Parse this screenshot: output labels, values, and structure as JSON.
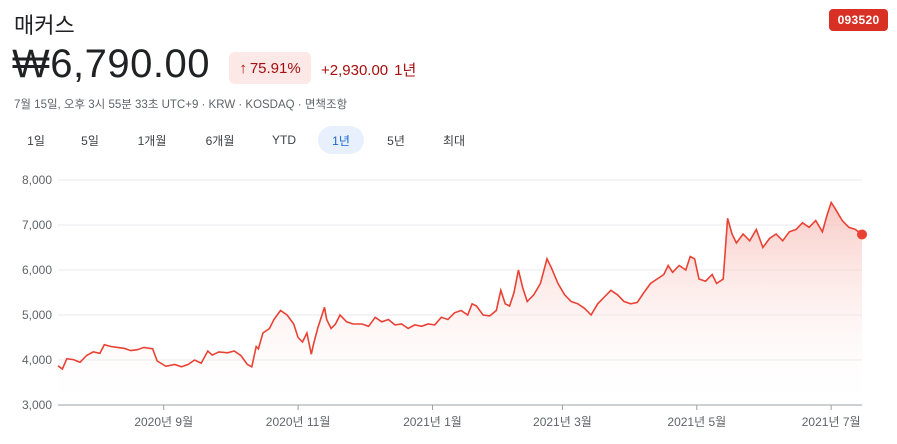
{
  "header": {
    "name": "매커스",
    "ticker": "093520",
    "price": "₩6,790.00",
    "pct_arrow": "↑",
    "pct_change": "75.91%",
    "abs_change": "+2,930.00",
    "period": "1년",
    "meta": "7월 15일, 오후 3시 55분 33초 UTC+9 · KRW · KOSDAQ · 면책조항"
  },
  "tabs": [
    {
      "label": "1일",
      "active": false
    },
    {
      "label": "5일",
      "active": false
    },
    {
      "label": "1개월",
      "active": false
    },
    {
      "label": "6개월",
      "active": false
    },
    {
      "label": "YTD",
      "active": false
    },
    {
      "label": "1년",
      "active": true
    },
    {
      "label": "5년",
      "active": false
    },
    {
      "label": "최대",
      "active": false
    }
  ],
  "colors": {
    "line": "#e94235",
    "fill_top": "#f6b8b2",
    "badge": "#d93025",
    "negative_text": "#a50e0e",
    "active_tab_bg": "#e8f0fe"
  },
  "chart_data": {
    "type": "area",
    "ylim": [
      3000,
      8000
    ],
    "yticks": [
      3000,
      4000,
      5000,
      6000,
      7000,
      8000
    ],
    "ytick_labels": [
      "3,000",
      "4,000",
      "5,000",
      "6,000",
      "7,000",
      "8,000"
    ],
    "xlim": [
      "2020-07-15",
      "2021-07-15"
    ],
    "xticks": [
      {
        "date": "2020-09-01",
        "label": "2020년 9월"
      },
      {
        "date": "2020-11-01",
        "label": "2020년 11월"
      },
      {
        "date": "2021-01-01",
        "label": "2021년 1월"
      },
      {
        "date": "2021-03-01",
        "label": "2021년 3월"
      },
      {
        "date": "2021-05-01",
        "label": "2021년 5월"
      },
      {
        "date": "2021-07-01",
        "label": "2021년 7월"
      }
    ],
    "grid": true,
    "series": [
      {
        "points": [
          [
            "2020-07-15",
            3870
          ],
          [
            "2020-07-17",
            3800
          ],
          [
            "2020-07-19",
            4030
          ],
          [
            "2020-07-22",
            4010
          ],
          [
            "2020-07-25",
            3950
          ],
          [
            "2020-07-28",
            4100
          ],
          [
            "2020-07-31",
            4180
          ],
          [
            "2020-08-03",
            4150
          ],
          [
            "2020-08-05",
            4340
          ],
          [
            "2020-08-08",
            4300
          ],
          [
            "2020-08-11",
            4280
          ],
          [
            "2020-08-14",
            4260
          ],
          [
            "2020-08-17",
            4210
          ],
          [
            "2020-08-20",
            4230
          ],
          [
            "2020-08-23",
            4280
          ],
          [
            "2020-08-27",
            4250
          ],
          [
            "2020-08-29",
            3980
          ],
          [
            "2020-09-02",
            3860
          ],
          [
            "2020-09-06",
            3900
          ],
          [
            "2020-09-09",
            3850
          ],
          [
            "2020-09-12",
            3900
          ],
          [
            "2020-09-15",
            4000
          ],
          [
            "2020-09-18",
            3930
          ],
          [
            "2020-09-21",
            4200
          ],
          [
            "2020-09-23",
            4110
          ],
          [
            "2020-09-26",
            4180
          ],
          [
            "2020-09-30",
            4160
          ],
          [
            "2020-10-03",
            4200
          ],
          [
            "2020-10-06",
            4100
          ],
          [
            "2020-10-09",
            3900
          ],
          [
            "2020-10-11",
            3850
          ],
          [
            "2020-10-13",
            4300
          ],
          [
            "2020-10-14",
            4250
          ],
          [
            "2020-10-16",
            4600
          ],
          [
            "2020-10-19",
            4700
          ],
          [
            "2020-10-21",
            4900
          ],
          [
            "2020-10-24",
            5100
          ],
          [
            "2020-10-27",
            5000
          ],
          [
            "2020-10-30",
            4800
          ],
          [
            "2020-11-01",
            4500
          ],
          [
            "2020-11-03",
            4400
          ],
          [
            "2020-11-05",
            4600
          ],
          [
            "2020-11-07",
            4130
          ],
          [
            "2020-11-08",
            4350
          ],
          [
            "2020-11-10",
            4720
          ],
          [
            "2020-11-13",
            5170
          ],
          [
            "2020-11-14",
            4900
          ],
          [
            "2020-11-16",
            4700
          ],
          [
            "2020-11-18",
            4800
          ],
          [
            "2020-11-20",
            5000
          ],
          [
            "2020-11-23",
            4850
          ],
          [
            "2020-11-26",
            4800
          ],
          [
            "2020-11-30",
            4800
          ],
          [
            "2020-12-03",
            4750
          ],
          [
            "2020-12-06",
            4950
          ],
          [
            "2020-12-09",
            4850
          ],
          [
            "2020-12-12",
            4900
          ],
          [
            "2020-12-15",
            4780
          ],
          [
            "2020-12-18",
            4800
          ],
          [
            "2020-12-21",
            4700
          ],
          [
            "2020-12-24",
            4780
          ],
          [
            "2020-12-27",
            4750
          ],
          [
            "2020-12-30",
            4800
          ],
          [
            "2021-01-02",
            4780
          ],
          [
            "2021-01-05",
            4950
          ],
          [
            "2021-01-08",
            4900
          ],
          [
            "2021-01-11",
            5050
          ],
          [
            "2021-01-14",
            5100
          ],
          [
            "2021-01-17",
            5000
          ],
          [
            "2021-01-19",
            5250
          ],
          [
            "2021-01-21",
            5200
          ],
          [
            "2021-01-24",
            5000
          ],
          [
            "2021-01-27",
            4980
          ],
          [
            "2021-01-30",
            5100
          ],
          [
            "2021-02-01",
            5550
          ],
          [
            "2021-02-03",
            5250
          ],
          [
            "2021-02-05",
            5200
          ],
          [
            "2021-02-07",
            5500
          ],
          [
            "2021-02-09",
            6000
          ],
          [
            "2021-02-11",
            5600
          ],
          [
            "2021-02-13",
            5300
          ],
          [
            "2021-02-16",
            5450
          ],
          [
            "2021-02-19",
            5700
          ],
          [
            "2021-02-22",
            6250
          ],
          [
            "2021-02-24",
            6050
          ],
          [
            "2021-02-27",
            5700
          ],
          [
            "2021-03-02",
            5450
          ],
          [
            "2021-03-05",
            5300
          ],
          [
            "2021-03-08",
            5250
          ],
          [
            "2021-03-11",
            5150
          ],
          [
            "2021-03-14",
            5000
          ],
          [
            "2021-03-17",
            5250
          ],
          [
            "2021-03-20",
            5400
          ],
          [
            "2021-03-23",
            5550
          ],
          [
            "2021-03-26",
            5450
          ],
          [
            "2021-03-29",
            5300
          ],
          [
            "2021-04-01",
            5250
          ],
          [
            "2021-04-04",
            5280
          ],
          [
            "2021-04-07",
            5500
          ],
          [
            "2021-04-10",
            5700
          ],
          [
            "2021-04-13",
            5800
          ],
          [
            "2021-04-16",
            5900
          ],
          [
            "2021-04-18",
            6100
          ],
          [
            "2021-04-20",
            5950
          ],
          [
            "2021-04-23",
            6100
          ],
          [
            "2021-04-26",
            6000
          ],
          [
            "2021-04-28",
            6300
          ],
          [
            "2021-04-30",
            6250
          ],
          [
            "2021-05-02",
            5800
          ],
          [
            "2021-05-05",
            5750
          ],
          [
            "2021-05-08",
            5900
          ],
          [
            "2021-05-10",
            5700
          ],
          [
            "2021-05-13",
            5800
          ],
          [
            "2021-05-15",
            7150
          ],
          [
            "2021-05-17",
            6800
          ],
          [
            "2021-05-19",
            6600
          ],
          [
            "2021-05-22",
            6800
          ],
          [
            "2021-05-25",
            6650
          ],
          [
            "2021-05-28",
            6900
          ],
          [
            "2021-05-31",
            6500
          ],
          [
            "2021-06-03",
            6700
          ],
          [
            "2021-06-06",
            6800
          ],
          [
            "2021-06-09",
            6650
          ],
          [
            "2021-06-12",
            6850
          ],
          [
            "2021-06-15",
            6900
          ],
          [
            "2021-06-18",
            7050
          ],
          [
            "2021-06-21",
            6950
          ],
          [
            "2021-06-24",
            7100
          ],
          [
            "2021-06-27",
            6850
          ],
          [
            "2021-06-29",
            7200
          ],
          [
            "2021-07-01",
            7500
          ],
          [
            "2021-07-03",
            7350
          ],
          [
            "2021-07-06",
            7100
          ],
          [
            "2021-07-09",
            6950
          ],
          [
            "2021-07-12",
            6900
          ],
          [
            "2021-07-15",
            6790
          ]
        ]
      }
    ]
  }
}
